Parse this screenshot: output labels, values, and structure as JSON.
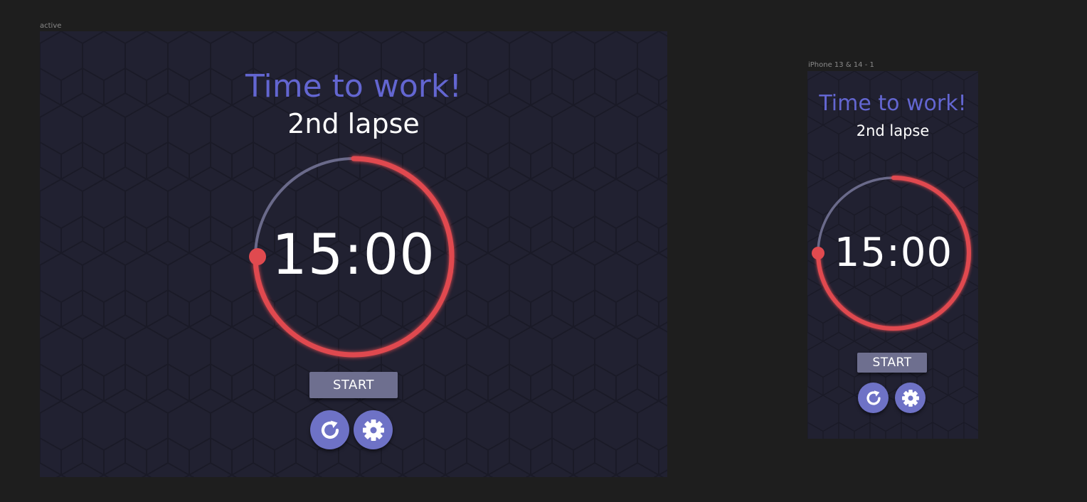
{
  "frames": {
    "desktop": {
      "label": "active",
      "title": "Time to work!",
      "subtitle": "2nd lapse",
      "time": "15:00",
      "start_label": "START"
    },
    "mobile": {
      "label": "iPhone 13 & 14 - 1",
      "title": "Time to work!",
      "subtitle": "2nd lapse",
      "time": "15:00",
      "start_label": "START"
    }
  },
  "icons": {
    "reset": "reset-icon",
    "settings": "gear-icon"
  },
  "colors": {
    "canvas_bg": "#1e1e1e",
    "frame_bg": "#212131",
    "title": "#6366d1",
    "progress": "#e04a4f",
    "track": "#6a6a8a",
    "start_button": "#6e6f8f",
    "round_button": "#6e72c6"
  },
  "progress": {
    "remaining_fraction": 0.75
  }
}
